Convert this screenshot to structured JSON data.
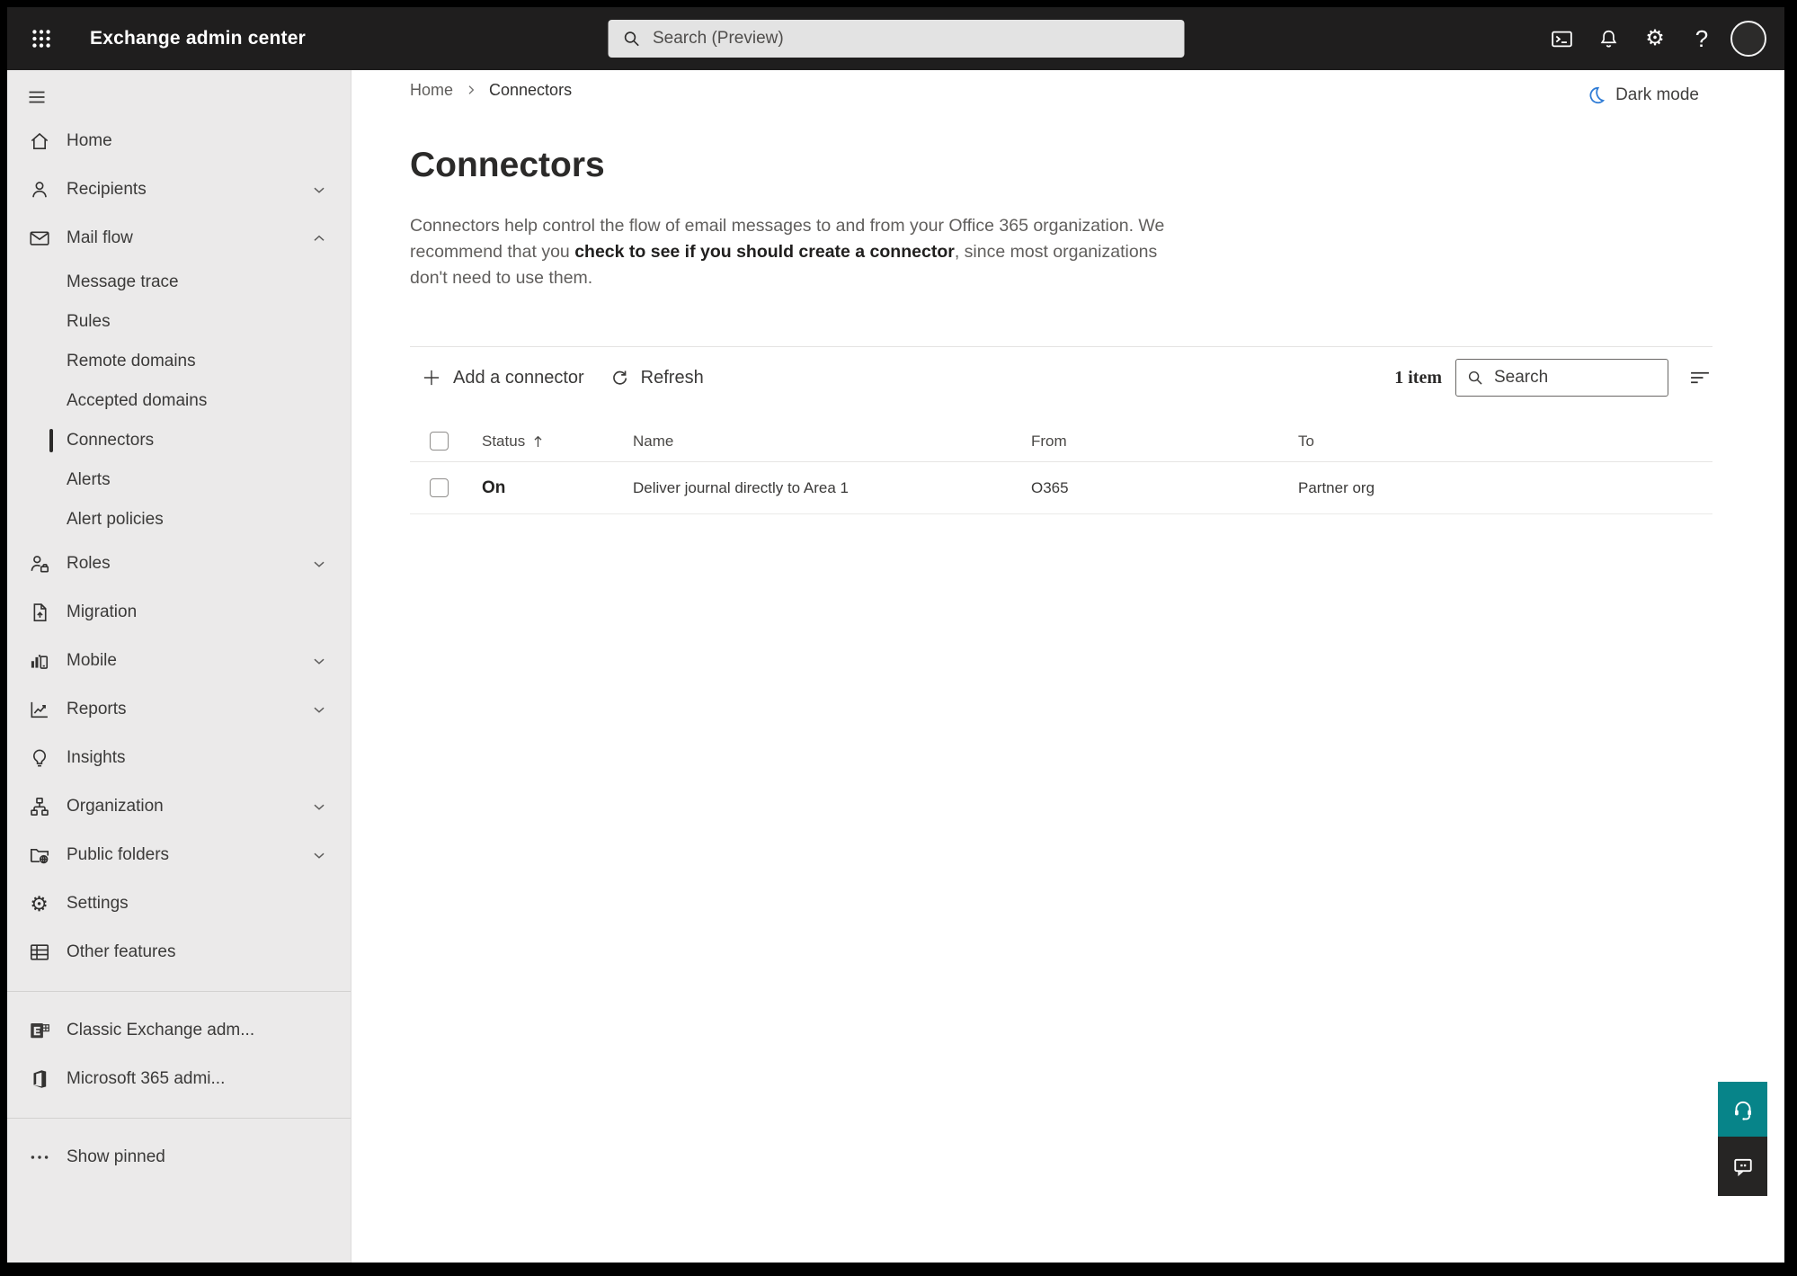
{
  "topbar": {
    "app_title": "Exchange admin center",
    "search_placeholder": "Search (Preview)"
  },
  "breadcrumb": {
    "home": "Home",
    "current": "Connectors"
  },
  "dark_mode_label": "Dark mode",
  "page": {
    "title": "Connectors",
    "description": {
      "before_link": "Connectors help control the flow of email messages to and from your Office 365 organization. We recommend that you ",
      "link": "check to see if you should create a connector",
      "after_link": ", since most organizations don't need to use them."
    }
  },
  "toolbar": {
    "add_label": "Add a connector",
    "refresh_label": "Refresh",
    "count_label": "1 item",
    "search_placeholder": "Search"
  },
  "table": {
    "columns": {
      "status": "Status",
      "name": "Name",
      "from": "From",
      "to": "To"
    },
    "rows": [
      {
        "status": "On",
        "name": "Deliver journal directly to Area 1",
        "from": "O365",
        "to": "Partner org"
      }
    ]
  },
  "sidebar": {
    "items": [
      {
        "label": "Home"
      },
      {
        "label": "Recipients",
        "expandable": true,
        "expanded": false
      },
      {
        "label": "Mail flow",
        "expandable": true,
        "expanded": true
      },
      {
        "label": "Message trace"
      },
      {
        "label": "Rules"
      },
      {
        "label": "Remote domains"
      },
      {
        "label": "Accepted domains"
      },
      {
        "label": "Connectors",
        "selected": true
      },
      {
        "label": "Alerts"
      },
      {
        "label": "Alert policies"
      },
      {
        "label": "Roles",
        "expandable": true,
        "expanded": false
      },
      {
        "label": "Migration"
      },
      {
        "label": "Mobile",
        "expandable": true,
        "expanded": false
      },
      {
        "label": "Reports",
        "expandable": true,
        "expanded": false
      },
      {
        "label": "Insights"
      },
      {
        "label": "Organization",
        "expandable": true,
        "expanded": false
      },
      {
        "label": "Public folders",
        "expandable": true,
        "expanded": false
      },
      {
        "label": "Settings"
      },
      {
        "label": "Other features"
      },
      {
        "label": "Classic Exchange adm..."
      },
      {
        "label": "Microsoft 365 admi..."
      },
      {
        "label": "Show pinned"
      }
    ]
  },
  "colors": {
    "topbar_bg": "#1f1e1e",
    "sidebar_bg": "#ebeaea",
    "selected_indicator": "#2b2a29",
    "help_fab_teal": "#078489",
    "feedback_fab_dark": "#262524",
    "moon_blue": "#2f7cd6"
  }
}
